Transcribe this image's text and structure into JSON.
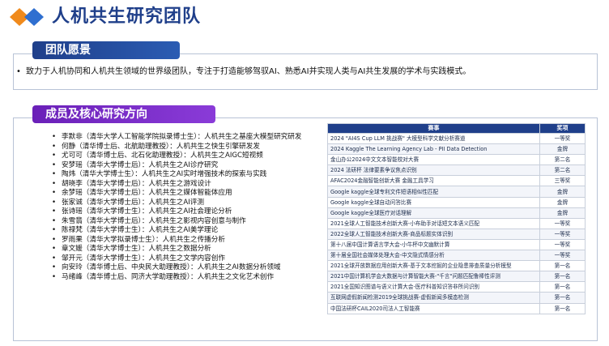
{
  "title": "人机共生研究团队",
  "vision": {
    "heading": "团队愿景",
    "text": "致力于人机协同和人机共生领域的世界级团队，专注于打造能够驾驭AI、熟悉AI并实现人类与AI共生发展的学术与实践模式。"
  },
  "members_section": {
    "heading": "成员及核心研究方向",
    "members": [
      "李默非（清华大学人工智能学院拟录博士生）：人机共生之基座大模型研究研发",
      "何静（清华博士后、北航助理教授）：人机共生之快生引擎研发发",
      "尤可可（清华博士后、北石化助理教授）：人机共生之AIGC短视频",
      "安梦瑶（清华大学博士后）：人机共生之AI诊疗研究",
      "陶炜（清华大学博士生）：人机共生之AI实时增强技术的探索与实践",
      "胡晓李（清华大学博士后）：人机共生之游戏设计",
      "余梦瑶（清华大学博士后）：人机共生之媒体智能体应用",
      "张家诚（清华大学博士后）：人机共生之AI评测",
      "张诗瑶（清华大学博士生）：人机共生之AI社会理论分析",
      "朱雪翡（清华大学博士后）：人机共生之影视内容创意与制作",
      "陈禄梵（清华大学博士生）：人机共生之AI美学理论",
      "罗雨果（清华大学拟录博士生）：人机共生之传播分析",
      "章文媛（清华大学博士生）：人机共生之数据分析",
      "邹开元（清华大学博士生）：人机共生之文学内容创作",
      "向安玲（清华博士后、中央民大助理教授）：人机共生之AI数据分析领域",
      "马绪峰（清华博士后、同济大学助理教授）：人机共生之文化艺术创作"
    ]
  },
  "awards": {
    "headers": [
      "赛事",
      "奖项"
    ],
    "rows": [
      [
        "2024 \"AI4S Cup LLM 挑战赛\" 大模型科学文献分析赛道",
        "一等奖"
      ],
      [
        "2024 Kaggle The Learning Agency Lab - PII Data Detection",
        "金牌"
      ],
      [
        "金山办公2024中文文本智能校对大赛",
        "第二名"
      ],
      [
        "2024 法研杯 法律要素争议焦点识别",
        "第二名"
      ],
      [
        "AFAC2024金融智能创新大赛 金融工具学习",
        "三等奖"
      ],
      [
        "Google kaggle全球专利文件短语相似性匹配",
        "金牌"
      ],
      [
        "Google kaggle全球自动问答比赛",
        "金牌"
      ],
      [
        "Google kaggle全球医疗对话理解",
        "金牌"
      ],
      [
        "2021全球人工智能技术创新大赛-小布助手对话短文本语义匹配",
        "一等奖"
      ],
      [
        "2022全球人工智能技术创新大赛-商品标题实体识别",
        "一等奖"
      ],
      [
        "第十八届中国计算语言学大会-小牛杯中文幽默计算",
        "一等奖"
      ],
      [
        "第十届全国社会媒体处理大会-中文隐式情感分析",
        "一等奖"
      ],
      [
        "2021全球开放数据应用创新大赛-基于文本挖掘的企业隐患排查质量分析模型",
        "第一名"
      ],
      [
        "2021中国计算机学会大数据与计算智能大赛-\"千言\"问题匹配鲁棒性评测",
        "第一名"
      ],
      [
        "2021全国知识图谱与语义计算大会-医疗科普知识答非所问识别",
        "第一名"
      ],
      [
        "互联网虚假新闻检测2019全球挑战赛-虚假新闻多模态检测",
        "第一名"
      ],
      [
        "中国法研杯CAIL2020司法人工智能赛",
        "第一名"
      ]
    ]
  },
  "colors": {
    "title": "#1f3f8a",
    "vision_banner": "#1f3f8a",
    "members_banner": "#6a20b8",
    "logo_orange": "#f08a1c",
    "logo_blue": "#2f6fd0",
    "table_header": "#1f3f8a"
  }
}
